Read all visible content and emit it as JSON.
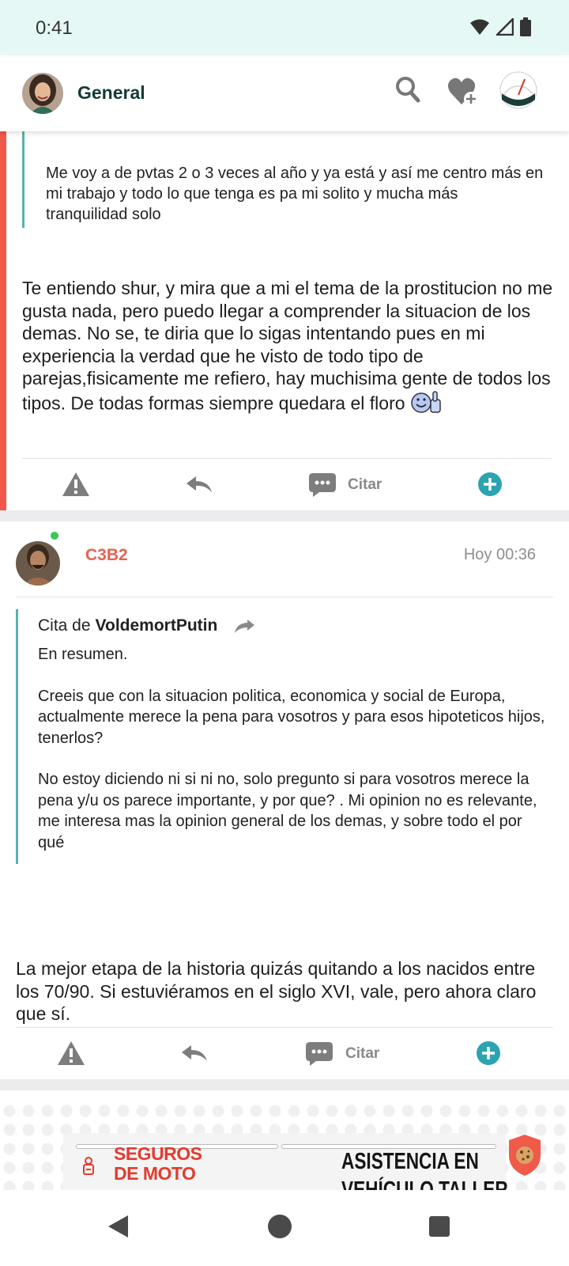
{
  "status_bar": {
    "time": "0:41"
  },
  "app_bar": {
    "title": "General",
    "icons": [
      "avatar",
      "search-icon",
      "heart-plus-icon",
      "gauge-icon"
    ]
  },
  "post1": {
    "quote": "Me voy a de pvtas 2 o 3 veces al año y ya está y así me centro más en mi trabajo y todo lo que tenga es pa mi solito y mucha más tranquilidad solo",
    "body": "Te entiendo shur, y mira que a mi el tema de la prostitucion no me gusta nada, pero puedo llegar a comprender la situacion de los demas. No se, te diria que lo sigas intentando pues en mi experiencia la verdad que he visto de todo tipo de parejas,fisicamente me refiero, hay muchisima gente de todos los tipos. De todas formas siempre quedara el floro",
    "actions": {
      "citar": "Citar"
    }
  },
  "post2": {
    "username": "C3B2",
    "time": "Hoy 00:36",
    "quote": {
      "cita_prefix": "Cita de",
      "cita_author": "VoldemortPutin",
      "p1": "En resumen.",
      "p2": "Creeis que con la situacion politica, economica y social de Europa, actualmente merece la pena para vosotros y para esos hipoteticos hijos, tenerlos?",
      "p3": "No estoy diciendo ni si ni no, solo pregunto si para vosotros merece la pena y/u os parece importante, y por que? . Mi opinion no es relevante, me interesa mas la opinion general de los demas, y sobre todo el por qué"
    },
    "body": "La mejor etapa de la historia quizás quitando a los nacidos entre los 70/90. Si estuviéramos en el siglo XVI, vale, pero ahora claro que sí.",
    "actions": {
      "citar": "Citar"
    }
  },
  "ad": {
    "left_line1": "SEGUROS",
    "left_line2": "DE MOTO",
    "right_line1": "ASISTENCIA EN",
    "right_line2": "VEHÍCULO TALLER"
  },
  "colors": {
    "accent_teal": "#2ba3b1",
    "quote_border": "#58b3ae",
    "highlight_red": "#f2574a",
    "username": "#e9604f"
  }
}
